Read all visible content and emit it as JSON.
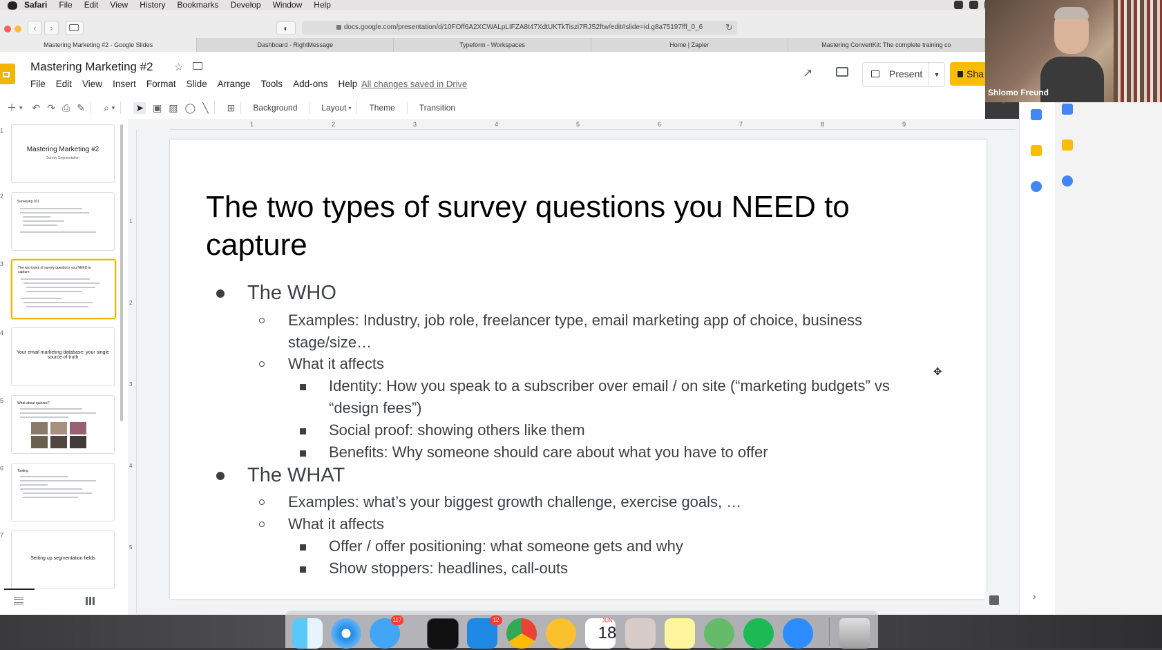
{
  "macos": {
    "app_name": "Safari",
    "menus": [
      "File",
      "Edit",
      "View",
      "History",
      "Bookmarks",
      "Develop",
      "Window",
      "Help"
    ]
  },
  "browser": {
    "url": "docs.google.com/presentation/d/10FOff6A2XCWALpLIFZA8t47XdtUKTkTiszi7RJS2ftw/edit#slide=id.g8a75197fff_0_6",
    "tabs": [
      {
        "label": "Mastering Marketing #2 - Google Slides",
        "active": true
      },
      {
        "label": "Dashboard - RightMessage",
        "active": false
      },
      {
        "label": "Typeform - Workspaces",
        "active": false
      },
      {
        "label": "Home | Zapier",
        "active": false
      },
      {
        "label": "Mastering ConvertKit: The complete training co",
        "active": false
      }
    ]
  },
  "slides_app": {
    "doc_title": "Mastering Marketing #2",
    "menu": [
      "File",
      "Edit",
      "View",
      "Insert",
      "Format",
      "Slide",
      "Arrange",
      "Tools",
      "Add-ons",
      "Help"
    ],
    "save_status": "All changes saved in Drive",
    "present_label": "Present",
    "share_label": "Sha",
    "toolbar_labels": {
      "background": "Background",
      "layout": "Layout",
      "theme": "Theme",
      "transition": "Transition"
    }
  },
  "filmstrip": [
    {
      "num": "1",
      "title": "Mastering Marketing #2",
      "subtitle": "Survey Segmentation"
    },
    {
      "num": "2",
      "title": "Surveying 101"
    },
    {
      "num": "3",
      "title": "The two types of survey questions you NEED to capture",
      "selected": true
    },
    {
      "num": "4",
      "title": "Your email marketing database: your single source of truth"
    },
    {
      "num": "5",
      "title": "What about quizzes?"
    },
    {
      "num": "6",
      "title": "Tooling"
    },
    {
      "num": "7",
      "title": "Setting up segmentation fields"
    }
  ],
  "rulers": {
    "horizontal": [
      "1",
      "2",
      "3",
      "4",
      "5",
      "6",
      "7",
      "8",
      "9"
    ],
    "vertical": [
      "1",
      "2",
      "3",
      "4",
      "5"
    ]
  },
  "slide": {
    "title": "The two types of survey questions you NEED to capture",
    "who": {
      "heading": "The WHO",
      "examples": "Examples: Industry, job role, freelancer type, email marketing app of choice, business stage/size…",
      "affects_label": "What it affects",
      "affects": [
        "Identity: How you speak to a subscriber over email / on site (“marketing budgets” vs “design fees”)",
        "Social proof: showing others like them",
        "Benefits: Why someone should care about what you have to offer"
      ]
    },
    "what": {
      "heading": "The WHAT",
      "examples": "Examples: what’s your biggest growth challenge, exercise goals, …",
      "affects_label": "What it affects",
      "affects": [
        "Offer / offer positioning: what someone gets and why",
        "Show stoppers: headlines, call-outs"
      ]
    }
  },
  "video": {
    "participant_name": "Shlomo Freund"
  },
  "dock": {
    "calendar_month": "JUN",
    "calendar_day": "18",
    "messages_badge": "117",
    "appstore_badge": "12",
    "apps": [
      "finder-icon",
      "safari-icon",
      "messages-icon",
      "terminal-icon",
      "app-store-icon",
      "chrome-icon",
      "vectorize-icon",
      "calendar-icon",
      "preview-icon",
      "notes-icon",
      "atom-icon",
      "spotify-icon",
      "zoom-icon",
      "trash-icon"
    ]
  }
}
